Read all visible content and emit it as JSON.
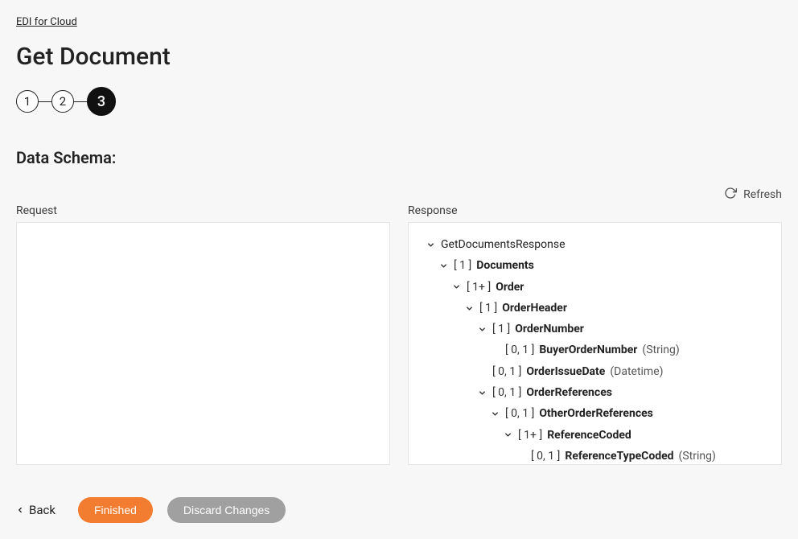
{
  "breadcrumb": "EDI for Cloud",
  "title": "Get Document",
  "steps": [
    "1",
    "2",
    "3"
  ],
  "activeStep": 3,
  "sectionHeading": "Data Schema:",
  "refreshLabel": "Refresh",
  "requestLabel": "Request",
  "responseLabel": "Response",
  "footer": {
    "back": "Back",
    "finished": "Finished",
    "discard": "Discard Changes"
  },
  "tree": [
    {
      "depth": 0,
      "expandable": true,
      "card": "",
      "name": "GetDocumentsResponse",
      "type": ""
    },
    {
      "depth": 1,
      "expandable": true,
      "card": "[ 1 ]",
      "name": "Documents",
      "type": ""
    },
    {
      "depth": 2,
      "expandable": true,
      "card": "[ 1+ ]",
      "name": "Order",
      "type": ""
    },
    {
      "depth": 3,
      "expandable": true,
      "card": "[ 1 ]",
      "name": "OrderHeader",
      "type": ""
    },
    {
      "depth": 4,
      "expandable": true,
      "card": "[ 1 ]",
      "name": "OrderNumber",
      "type": ""
    },
    {
      "depth": 5,
      "expandable": false,
      "card": "[ 0, 1 ]",
      "name": "BuyerOrderNumber",
      "type": "(String)"
    },
    {
      "depth": 4,
      "expandable": false,
      "card": "[ 0, 1 ]",
      "name": "OrderIssueDate",
      "type": "(Datetime)"
    },
    {
      "depth": 4,
      "expandable": true,
      "card": "[ 0, 1 ]",
      "name": "OrderReferences",
      "type": ""
    },
    {
      "depth": 5,
      "expandable": true,
      "card": "[ 0, 1 ]",
      "name": "OtherOrderReferences",
      "type": ""
    },
    {
      "depth": 6,
      "expandable": true,
      "card": "[ 1+ ]",
      "name": "ReferenceCoded",
      "type": ""
    },
    {
      "depth": 7,
      "expandable": false,
      "card": "[ 0, 1 ]",
      "name": "ReferenceTypeCoded",
      "type": "(String)"
    }
  ]
}
